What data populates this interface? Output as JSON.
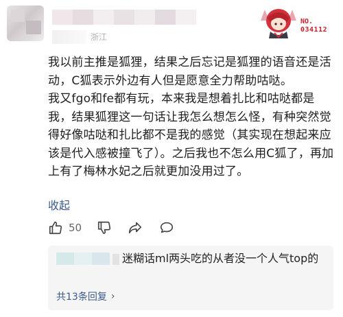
{
  "header": {
    "meta_text": "| 属地：浙江",
    "badge_no_label": "NO.",
    "badge_no_value": "034112"
  },
  "comment": {
    "paragraph_1": "我以前主推是狐狸，结果之后忘记是狐狸的语音还是活动，C狐表示外边有人但是愿意全力帮助咕哒。",
    "paragraph_2": "我又fgo和fe都有玩，本来我是想着扎比和咕哒都是我，结果狐狸这一句话让我怎么想怎么怪，有种突然觉得好像咕哒和扎比都不是我的感觉（其实现在想起来应该是代入感被撞飞了）。之后我也不怎么用C狐了，再加上有了梅林水妃之后就更加没用过了。",
    "collapse_label": "收起"
  },
  "actions": {
    "like_count": "50",
    "icons": [
      "thumbs-up-icon",
      "thumbs-down-icon",
      "share-icon",
      "comment-icon"
    ]
  },
  "reply": {
    "text": "迷糊话ml两头吃的从者没一个人气top的",
    "more_label": "共13条回复"
  },
  "colors": {
    "link": "#3a5a8c",
    "text": "#1e1e1e",
    "badge_red": "#c8202a",
    "reply_bg": "#f5f5f5"
  }
}
